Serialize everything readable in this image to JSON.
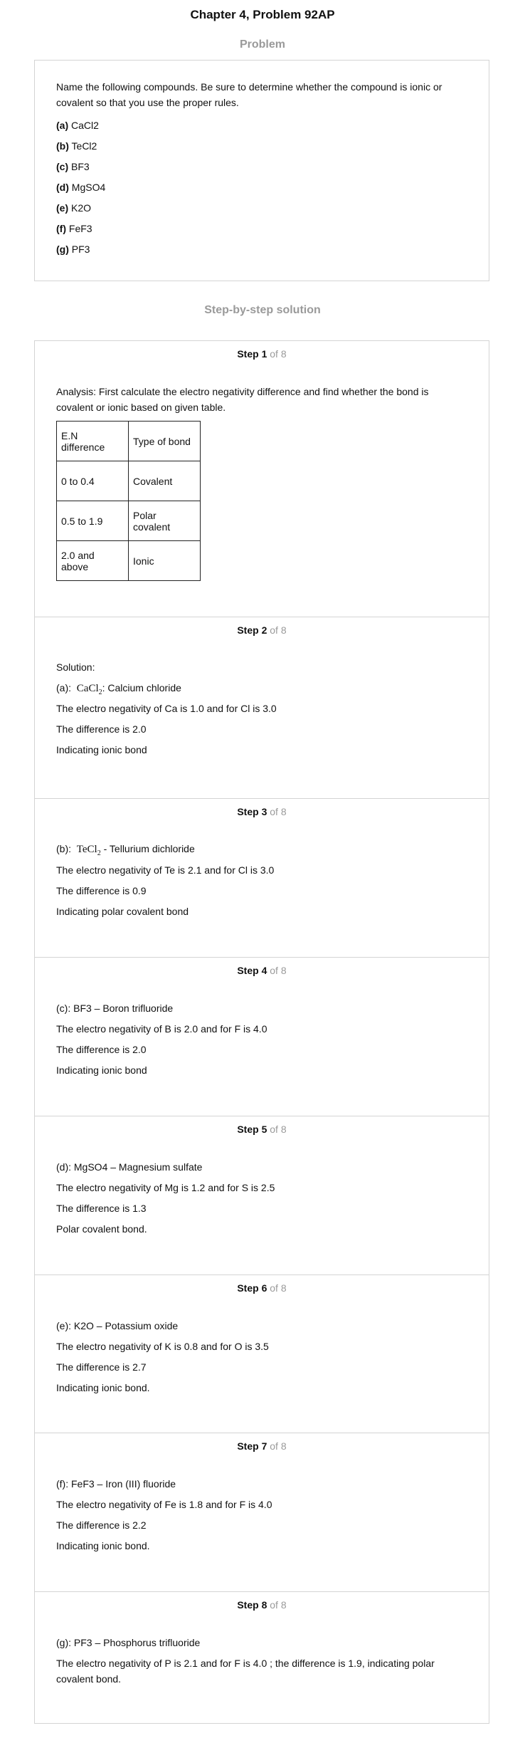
{
  "header": {
    "title": "Chapter 4, Problem 92AP"
  },
  "problem": {
    "heading": "Problem",
    "intro_line1": "Name the following compounds. Be sure to determine whether the compound is ionic or",
    "intro_line2": "covalent so that you use the proper rules.",
    "items": [
      {
        "label": "(a)",
        "formula": "CaCl2"
      },
      {
        "label": "(b)",
        "formula": "TeCl2"
      },
      {
        "label": "(c)",
        "formula": "BF3"
      },
      {
        "label": "(d)",
        "formula": "MgSO4"
      },
      {
        "label": "(e)",
        "formula": "K2O"
      },
      {
        "label": "(f)",
        "formula": "FeF3"
      },
      {
        "label": "(g)",
        "formula": "PF3"
      }
    ]
  },
  "solution": {
    "heading": "Step-by-step solution",
    "step_word": "Step",
    "of_word": "of",
    "total": "8",
    "step1": {
      "num": "1",
      "line1": "Analysis: First calculate the electro negativity difference and find whether the bond is",
      "line2": "covalent or ionic based on given table.",
      "table": [
        [
          "E.N difference",
          "Type of bond"
        ],
        [
          "0 to 0.4",
          "Covalent"
        ],
        [
          "0.5 to 1.9",
          "Polar covalent"
        ],
        [
          "2.0 and above",
          "Ionic"
        ]
      ]
    },
    "step2": {
      "num": "2",
      "lead": "Solution:",
      "prefix": "(a):",
      "el": "CaCl",
      "sub": "2",
      "suffix": ": Calcium chloride",
      "l1": "The electro negativity of Ca is 1.0 and for Cl is 3.0",
      "l2": "The difference is 2.0",
      "l3": "Indicating ionic bond"
    },
    "step3": {
      "num": "3",
      "prefix": "(b):",
      "el": "TeCl",
      "sub": "2",
      "suffix": " - Tellurium dichloride",
      "l1": "The electro negativity of Te is 2.1 and for Cl is 3.0",
      "l2": "The difference is 0.9",
      "l3": "Indicating polar covalent bond"
    },
    "step4": {
      "num": "4",
      "head": "(c): BF3 – Boron trifluoride",
      "l1": "The electro negativity of B is 2.0 and for F is 4.0",
      "l2": "The difference is 2.0",
      "l3": "Indicating ionic bond"
    },
    "step5": {
      "num": "5",
      "head": "(d): MgSO4 – Magnesium sulfate",
      "l1": "The electro negativity of Mg is 1.2 and for S is 2.5",
      "l2": "The difference is 1.3",
      "l3": "Polar covalent bond."
    },
    "step6": {
      "num": "6",
      "head": "(e): K2O – Potassium oxide",
      "l1": "The electro negativity of K is 0.8 and for O is 3.5",
      "l2": "The difference is 2.7",
      "l3": "Indicating ionic bond."
    },
    "step7": {
      "num": "7",
      "head": "(f): FeF3 – Iron (III) fluoride",
      "l1": "The electro negativity of Fe is 1.8 and for F is 4.0",
      "l2": "The difference is 2.2",
      "l3": "Indicating ionic bond."
    },
    "step8": {
      "num": "8",
      "head": "(g): PF3 – Phosphorus trifluoride",
      "l1": "The electro negativity of P is 2.1 and for F is 4.0 ; the difference is 1.9, indicating polar",
      "l2": "covalent bond."
    }
  }
}
